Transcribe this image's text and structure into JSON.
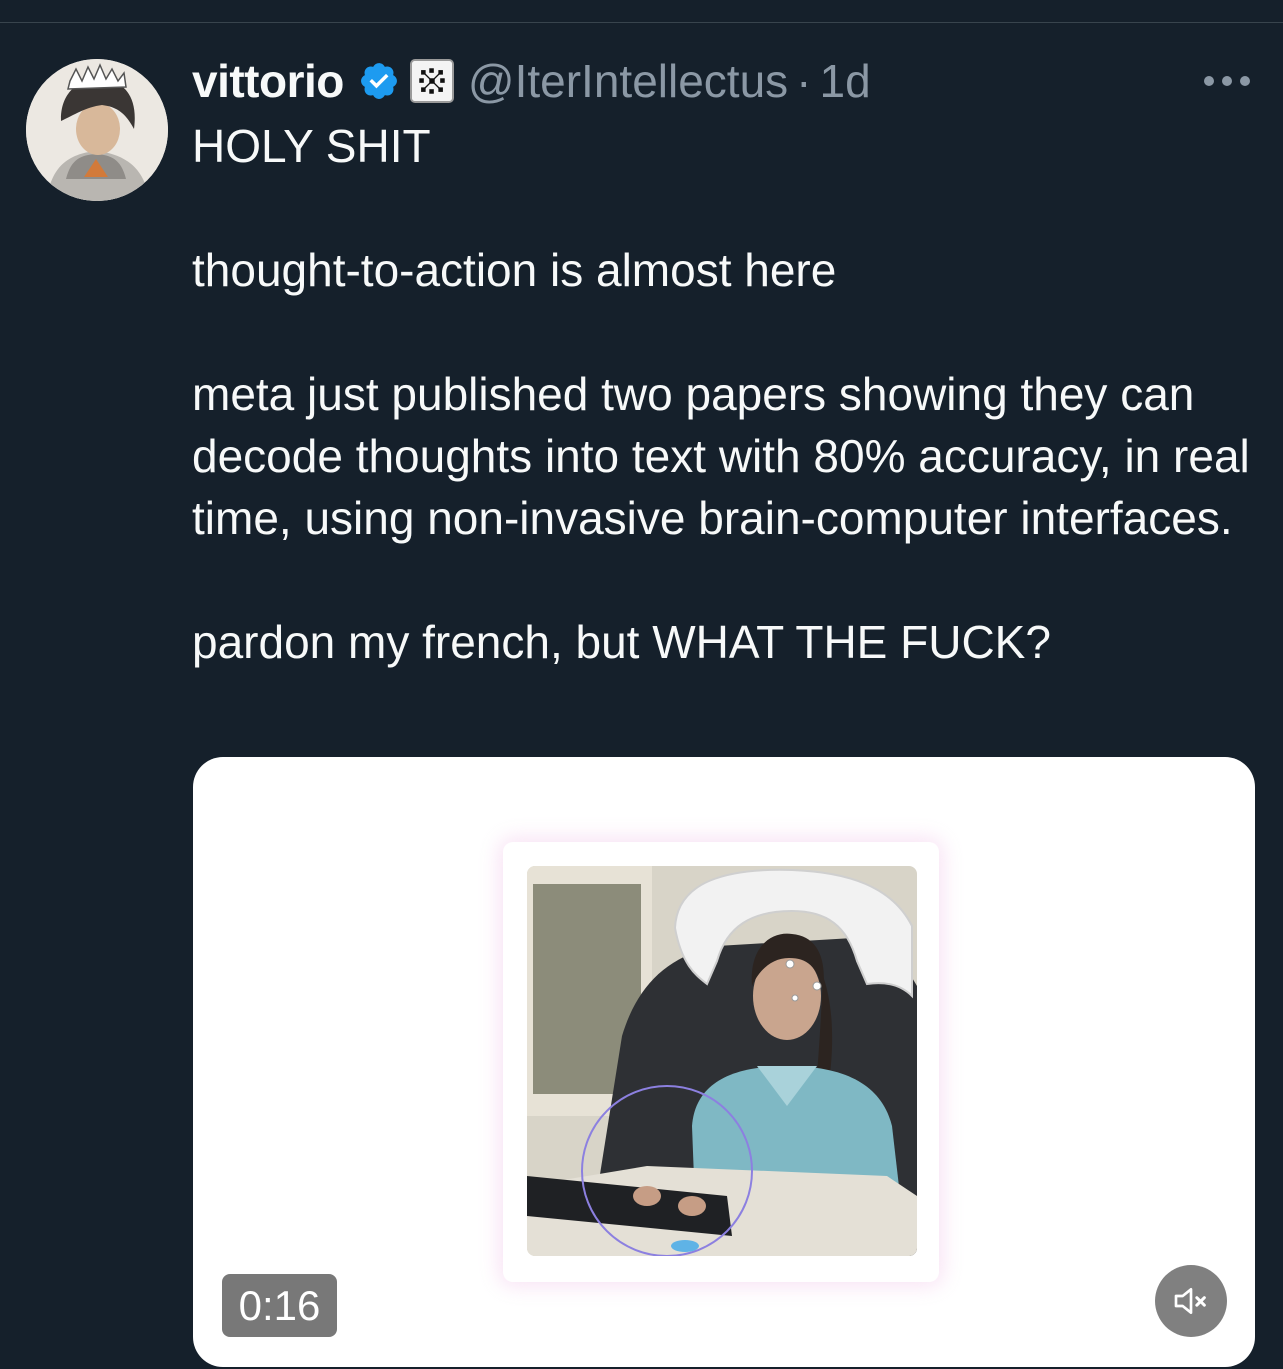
{
  "tweet": {
    "author_name": "vittorio",
    "handle": "@IterIntellectus",
    "separator": "·",
    "time_ago": "1d",
    "verified_icon": "verified-badge-icon",
    "affiliation_icon": "affiliation-badge-icon",
    "more_icon": "more-options-icon",
    "text": "HOLY SHIT\n\nthought-to-action is almost here\n\nmeta just published two papers showing they can decode thoughts into text with 80% accuracy, in real time, using non-invasive brain-computer interfaces.\n\npardon my french, but WHAT THE FUCK?",
    "media": {
      "type": "video",
      "duration": "0:16",
      "muted": true,
      "mute_icon": "speaker-muted-icon"
    }
  },
  "colors": {
    "background": "#15202b",
    "text_primary": "#f7f9f9",
    "text_secondary": "#8b98a5",
    "verified_blue": "#1d9bf0"
  }
}
